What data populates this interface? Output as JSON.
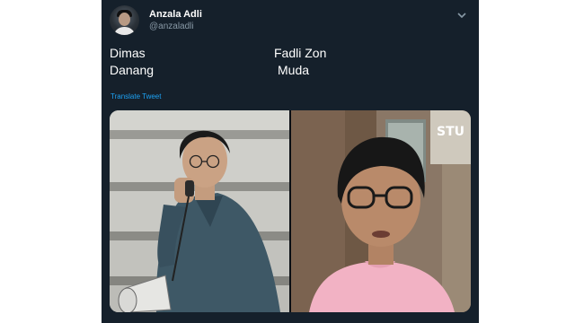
{
  "tweet": {
    "author": {
      "display_name": "Anzala Adli",
      "handle": "@anzaladli"
    },
    "text": {
      "left_col": [
        "Dimas",
        "Danang"
      ],
      "right_col": [
        "Fadli Zon",
        "Muda"
      ]
    },
    "translate_label": "Translate Tweet",
    "menu_icon": "chevron-down-icon"
  },
  "media": {
    "photos": [
      {
        "subject": "young man with glasses speaking into megaphone, denim shirt, black and white steps"
      },
      {
        "subject": "young man with glasses in pink t-shirt, indoor"
      }
    ]
  },
  "colors": {
    "background": "#15202b",
    "text": "#ffffff",
    "secondary": "#8899a6",
    "link": "#1da1f2",
    "page": "#ffffff"
  }
}
